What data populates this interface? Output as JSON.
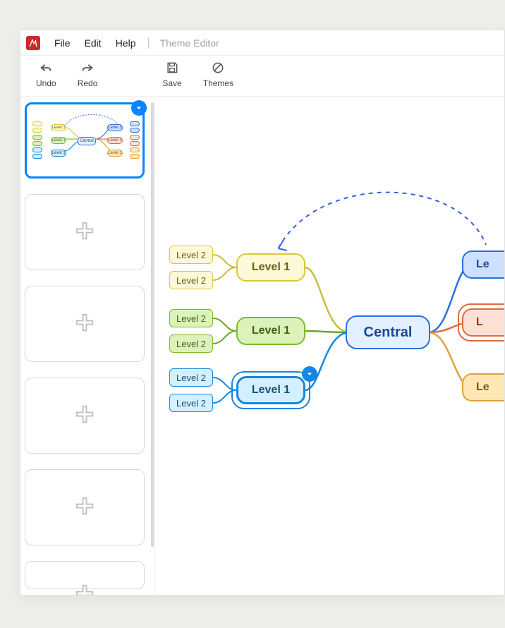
{
  "menubar": {
    "items": [
      "File",
      "Edit",
      "Help"
    ],
    "context_label": "Theme Editor"
  },
  "toolbar": {
    "undo": "Undo",
    "redo": "Redo",
    "save": "Save",
    "themes": "Themes"
  },
  "sidebar": {
    "slides": [
      {
        "type": "theme",
        "selected": true
      },
      {
        "type": "add"
      },
      {
        "type": "add"
      },
      {
        "type": "add"
      },
      {
        "type": "add"
      },
      {
        "type": "add"
      }
    ]
  },
  "mindmap": {
    "central": "Central",
    "left": [
      {
        "label": "Level 1",
        "color": "yellow",
        "children": [
          "Level 2",
          "Level 2"
        ]
      },
      {
        "label": "Level 1",
        "color": "green",
        "children": [
          "Level 2",
          "Level 2"
        ]
      },
      {
        "label": "Level 1",
        "color": "blue",
        "children": [
          "Level 2",
          "Level 2"
        ],
        "selected": true
      }
    ],
    "right_partial": [
      {
        "label": "Le",
        "color": "blue"
      },
      {
        "label": "L",
        "color": "red",
        "selected": true
      },
      {
        "label": "Le",
        "color": "orange"
      }
    ]
  },
  "thumb": {
    "central": "Central",
    "l1": "Level 1"
  }
}
